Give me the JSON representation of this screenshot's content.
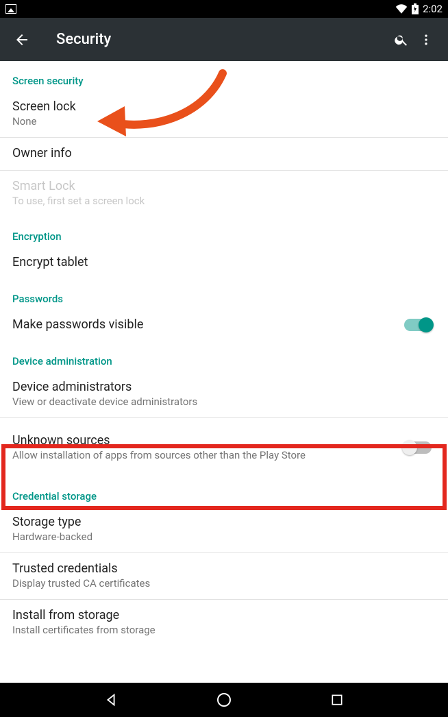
{
  "status": {
    "time": "2:02"
  },
  "appbar": {
    "title": "Security"
  },
  "sections": {
    "screen_security": {
      "header": "Screen security",
      "screen_lock": {
        "title": "Screen lock",
        "sub": "None"
      },
      "owner_info": {
        "title": "Owner info"
      },
      "smart_lock": {
        "title": "Smart Lock",
        "sub": "To use, first set a screen lock"
      }
    },
    "encryption": {
      "header": "Encryption",
      "encrypt": {
        "title": "Encrypt tablet"
      }
    },
    "passwords": {
      "header": "Passwords",
      "visible": {
        "title": "Make passwords visible",
        "toggled": true
      }
    },
    "device_admin": {
      "header": "Device administration",
      "admins": {
        "title": "Device administrators",
        "sub": "View or deactivate device administrators"
      },
      "unknown": {
        "title": "Unknown sources",
        "sub": "Allow installation of apps from sources other than the Play Store",
        "toggled": false
      }
    },
    "credential": {
      "header": "Credential storage",
      "storage_type": {
        "title": "Storage type",
        "sub": "Hardware-backed"
      },
      "trusted": {
        "title": "Trusted credentials",
        "sub": "Display trusted CA certificates"
      },
      "install": {
        "title": "Install from storage",
        "sub": "Install certificates from storage"
      }
    }
  }
}
